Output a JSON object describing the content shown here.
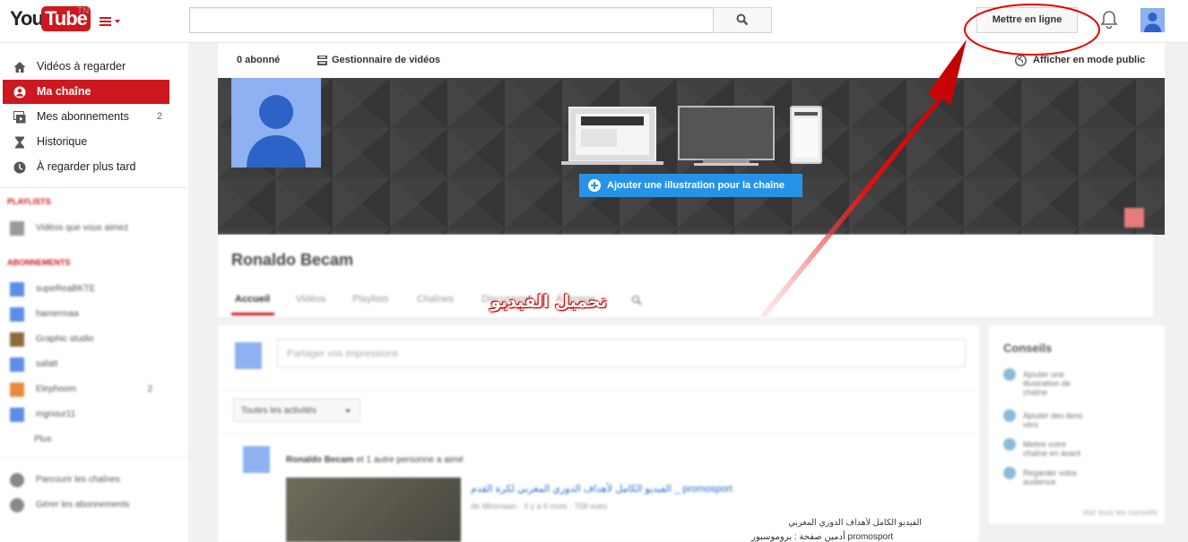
{
  "masthead": {
    "logo_you": "You",
    "logo_tube": "Tube",
    "logo_country": "TN",
    "search_placeholder": "",
    "upload_label": "Mettre en ligne"
  },
  "sidebar": {
    "items": [
      {
        "label": "Vidéos à regarder",
        "icon": "home-icon"
      },
      {
        "label": "Ma chaîne",
        "icon": "user-circle-icon"
      },
      {
        "label": "Mes abonnements",
        "icon": "subscriptions-icon",
        "count": "2"
      },
      {
        "label": "Historique",
        "icon": "hourglass-icon"
      },
      {
        "label": "À regarder plus tard",
        "icon": "clock-icon"
      }
    ],
    "playlists_title": "PLAYLISTS",
    "liked_videos": "Vidéos que vous aimez",
    "subscriptions_title": "ABONNEMENTS",
    "subscriptions": [
      {
        "name": "supeReaBKTE",
        "color": "#5d8de8"
      },
      {
        "name": "hamermaa",
        "color": "#5d8de8"
      },
      {
        "name": "Graphic studio",
        "color": "#8a6a3a"
      },
      {
        "name": "safatt",
        "color": "#5d8de8"
      },
      {
        "name": "Elephoom",
        "color": "#e98a3a",
        "count": "2"
      },
      {
        "name": "mgnour11",
        "color": "#5d8de8"
      }
    ],
    "more": "Plus",
    "browse_channels": "Parcourir les chaînes",
    "manage_subscriptions": "Gérer les abonnements"
  },
  "channel": {
    "subscribers": "0 abonné",
    "video_manager": "Gestionnaire de vidéos",
    "public_view": "Afficher en mode public",
    "add_art": "Ajouter une illustration pour la chaîne",
    "name": "Ronaldo Becam",
    "tabs": [
      "Accueil",
      "Vidéos",
      "Playlists",
      "Chaînes",
      "Discussion",
      "À propos"
    ],
    "share_placeholder": "Partager vos impressions",
    "activity_filter": "Toutes les activités",
    "feed_author": "Ronaldo Becam",
    "feed_action": "et 1 autre personne a aimé",
    "feed_link": "promosport _ الفيديو الكامل لأهداف الدوري المغربي لكرة القدم",
    "feed_meta": "de Minimaan · Il y a 6 mois · 758 vues",
    "feed_desc_1": "الفيديو الكامل لأهداف الدوري المغربي",
    "feed_desc_2": "أدمين صفحة : بروموسبور  promosport"
  },
  "tips": {
    "title": "Conseils",
    "items": [
      "Ajouter une illustration de chaîne",
      "Ajouter des liens vers",
      "Mettre votre chaîne en avant",
      "Regarder votre audience"
    ],
    "more": "Voir tous les conseils"
  },
  "annotation": {
    "text": "تحميل الفيديو",
    "color": "#e00000"
  }
}
